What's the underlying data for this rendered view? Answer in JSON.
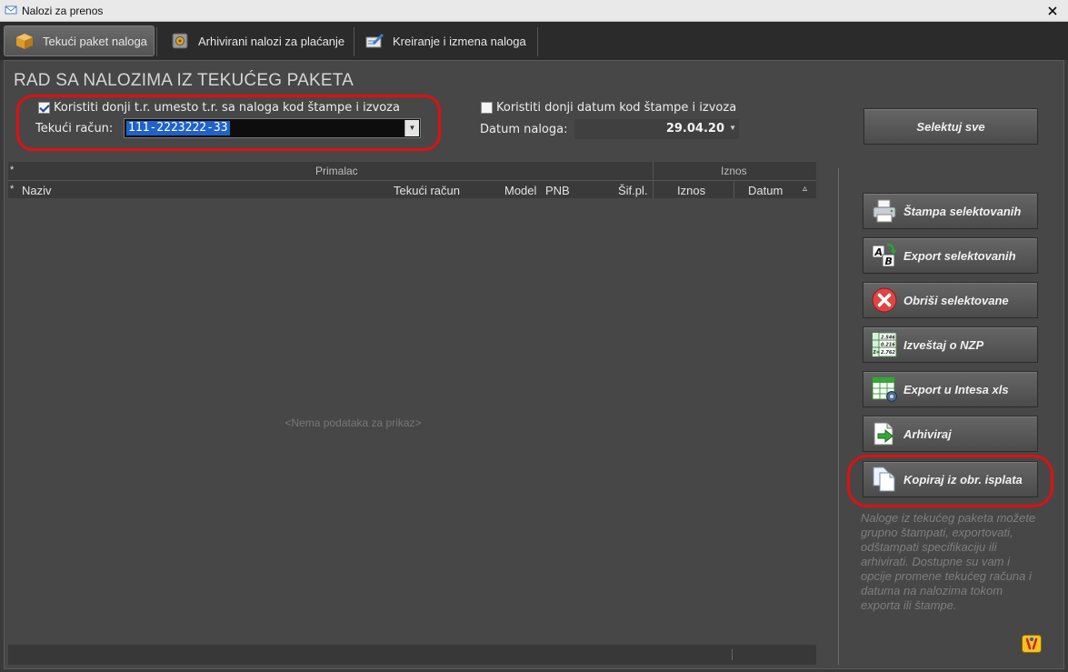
{
  "window": {
    "title": "Nalozi za prenos"
  },
  "tabs": [
    {
      "label": "Tekući paket naloga",
      "icon": "package-icon"
    },
    {
      "label": "Arhivirani nalozi za plaćanje",
      "icon": "archive-safe-icon"
    },
    {
      "label": "Kreiranje i izmena naloga",
      "icon": "edit-document-icon"
    }
  ],
  "page": {
    "title": "RAD SA NALOZIMA IZ TEKUĆEG PAKETA",
    "use_account": {
      "label": "Koristiti donji t.r. umesto t.r. sa naloga kod štampe i izvoza",
      "checked": true
    },
    "account": {
      "label": "Tekući račun:",
      "value": "111-2223222-33"
    },
    "use_date": {
      "label": "Koristiti donji datum kod štampe i izvoza",
      "checked": false
    },
    "date": {
      "label": "Datum naloga:",
      "value": "29.04.20"
    }
  },
  "grid": {
    "group_headers": {
      "row_marker": "*",
      "primalac": "Primalac",
      "iznos": "Iznos"
    },
    "columns": {
      "row_marker": "*",
      "naziv": "Naziv",
      "tekuci_racun": "Tekući račun",
      "model": "Model",
      "pnb": "PNB",
      "sif_pl": "Šif.pl.",
      "iznos": "Iznos",
      "datum": "Datum",
      "sort": "▵"
    },
    "empty_text": "<Nema podataka za prikaz>"
  },
  "actions": {
    "select_all": "Selektuj sve",
    "print": "Štampa selektovanih",
    "export": "Export selektovanih",
    "delete": "Obriši selektovane",
    "report": "Izveštaj o NZP",
    "export_intesa": "Export u Intesa xls",
    "archive": "Arhiviraj",
    "copy": "Kopiraj iz obr. isplata",
    "report_icon_numbers": [
      "2.546",
      "0.216",
      "2.762"
    ],
    "report_icon_sum": "Σ="
  },
  "help_text": "Naloge iz tekućeg paketa možete grupno štampati, exportovati, odštampati specifikaciju ili arhivirati. Dostupne su vam i opcije promene tekućeg računa i datuma na nalozima tokom exporta ili štampe.",
  "colors": {
    "highlight_ring": "#e01010",
    "selection": "#1f63c9",
    "panel": "#474747"
  }
}
